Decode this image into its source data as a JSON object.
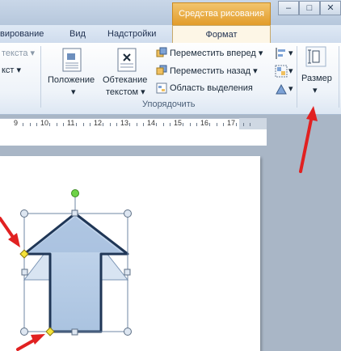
{
  "contextual_tab": "Средства рисования",
  "tabs": {
    "review": "вирование",
    "view": "Вид",
    "addins": "Надстройки",
    "format": "Формат"
  },
  "ribbon": {
    "left_partial_1": "текста ▾",
    "left_partial_2": "кст ▾",
    "position_line1": "Положение",
    "wrap_line1": "Обтекание",
    "wrap_line2": "текстом ▾",
    "bring_forward": "Переместить вперед ▾",
    "send_backward": "Переместить назад ▾",
    "selection_pane": "Область выделения",
    "group_label": "Упорядочить",
    "size_label": "Размер"
  },
  "ruler": {
    "numbers": [
      "9",
      "10",
      "11",
      "12",
      "13",
      "14",
      "15",
      "16",
      "17"
    ]
  },
  "window_controls": {
    "minimize": "–",
    "maximize": "□",
    "close": "✕"
  }
}
